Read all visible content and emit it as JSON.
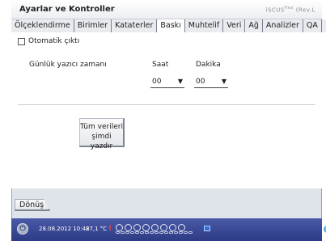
{
  "window": {
    "title": "Ayarlar ve Kontroller",
    "brand": "iSCUS",
    "brand_sup": "flex",
    "brand_suffix": "(Rev.L"
  },
  "tabs": [
    {
      "label": "Ölçeklendirme",
      "active": false
    },
    {
      "label": "Birimler",
      "active": false
    },
    {
      "label": "Kataterler",
      "active": false
    },
    {
      "label": "Baskı",
      "active": true
    },
    {
      "label": "Muhtelif",
      "active": false
    },
    {
      "label": "Veri",
      "active": false
    },
    {
      "label": "Ağ",
      "active": false
    },
    {
      "label": "Analizler",
      "active": false
    },
    {
      "label": "QA",
      "active": false
    }
  ],
  "print_settings": {
    "auto_print_label": "Otomatik çıktı",
    "auto_print_checked": false,
    "schedule_label": "Günlük yazıcı zamanı",
    "hour_label": "Saat",
    "minute_label": "Dakika",
    "hour_value": "00",
    "minute_value": "00",
    "print_all_line1": "Tüm verileri",
    "print_all_line2": "şimdi yazdır"
  },
  "footer": {
    "back_label": "Dönüş"
  },
  "status": {
    "datetime": "28.08.2012 10:48",
    "temperature": "27,1 °C",
    "alert_symbol": "!"
  },
  "icons": {
    "power": "power-icon",
    "alert": "alert-icon",
    "network": "network-icon",
    "globe": "globe-icon"
  },
  "colors": {
    "statusbar": "#3a4896",
    "alert": "#ff4040",
    "frame": "#dfe3ea"
  }
}
